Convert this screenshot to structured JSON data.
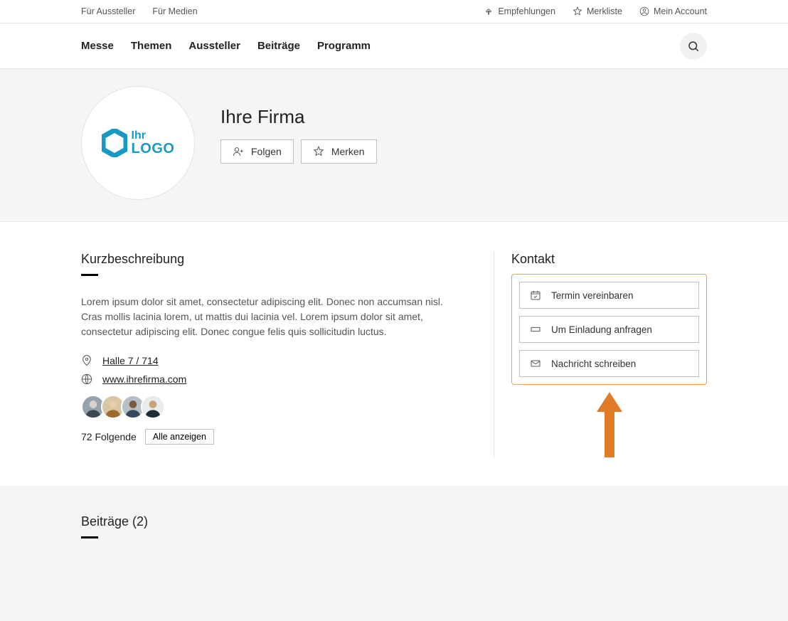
{
  "utilbar": {
    "left": [
      "Für Aussteller",
      "Für Medien"
    ],
    "right": {
      "recommendations": "Empfehlungen",
      "watchlist": "Merkliste",
      "account": "Mein Account"
    }
  },
  "mainnav": [
    "Messe",
    "Themen",
    "Aussteller",
    "Beiträge",
    "Programm"
  ],
  "company": {
    "logo_line1": "Ihr",
    "logo_line2": "LOGO",
    "name": "Ihre Firma",
    "follow_label": "Folgen",
    "bookmark_label": "Merken"
  },
  "kurz": {
    "heading": "Kurzbeschreibung",
    "text": "Lorem ipsum dolor sit amet, consectetur adipiscing elit. Donec non accumsan nisl. Cras mollis lacinia lorem, ut mattis dui lacinia vel. Lorem ipsum dolor sit amet, consectetur adipiscing elit. Donec congue felis quis sollicitudin luctus.",
    "location": "Halle 7 / 714",
    "website": "www.ihrefirma.com",
    "followers_label": "72 Folgende",
    "showall_label": "Alle anzeigen"
  },
  "kontakt": {
    "heading": "Kontakt",
    "btn1": "Termin vereinbaren",
    "btn2": "Um Einladung anfragen",
    "btn3": "Nachricht schreiben"
  },
  "posts": {
    "heading": "Beiträge (2)"
  }
}
